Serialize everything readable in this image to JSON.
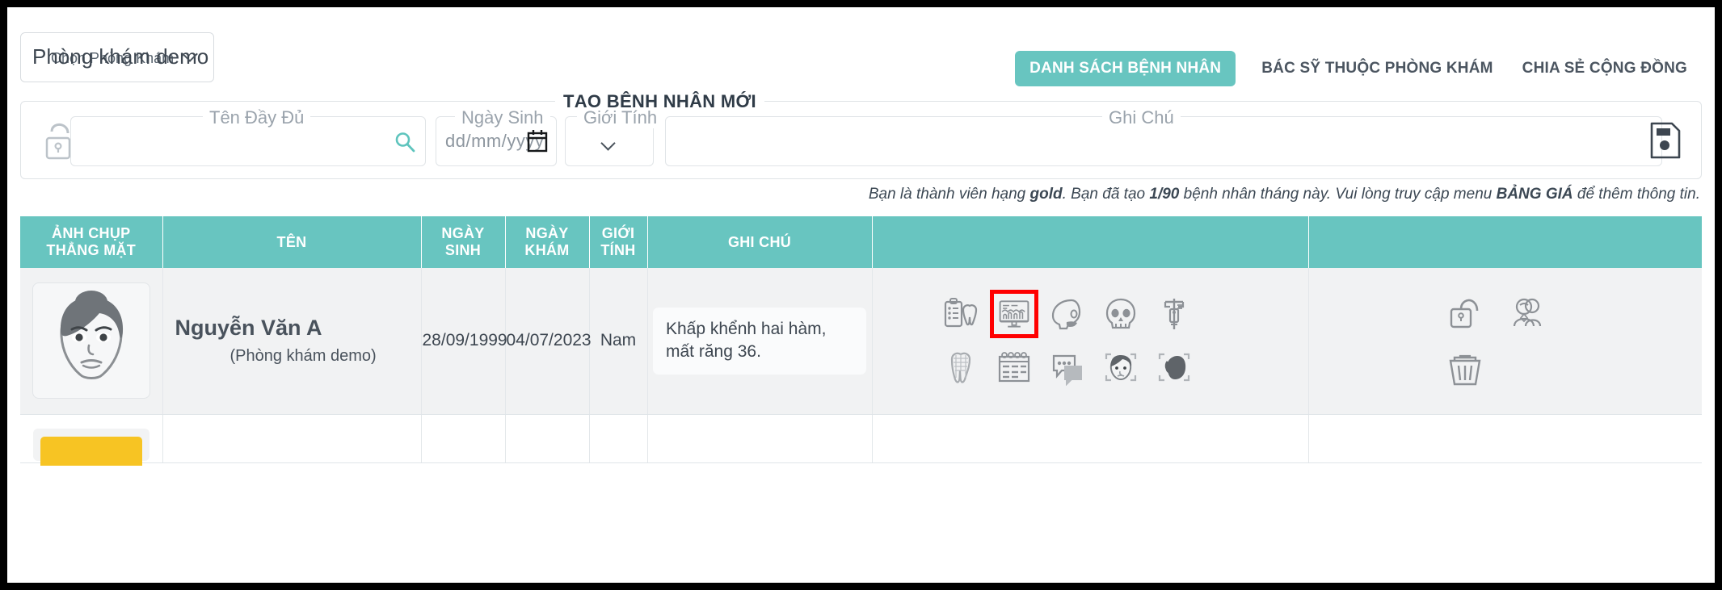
{
  "clinic_selector": {
    "legend": "Chọn Phòng Khám",
    "value": "Phòng khám demo",
    "caret_icon": "chevron-down-icon"
  },
  "nav": {
    "items": [
      {
        "label": "DANH SÁCH BỆNH NHÂN",
        "active": true
      },
      {
        "label": "BÁC SỸ THUỘC PHÒNG KHÁM",
        "active": false
      },
      {
        "label": "CHIA SẺ CỘNG ĐỒNG",
        "active": false
      }
    ]
  },
  "create_patient": {
    "legend": "TẠO BỆNH NHÂN MỚI",
    "lock_icon": "unlock-icon",
    "save_icon": "save-floppy-icon",
    "fields": {
      "full_name": {
        "legend": "Tên Đầy Đủ",
        "value": "",
        "placeholder": "",
        "icon": "search-icon"
      },
      "birth_date": {
        "legend": "Ngày Sinh",
        "value": "",
        "placeholder": "dd/mm/yyyy",
        "icon": "calendar-icon"
      },
      "gender": {
        "legend": "Giới Tính",
        "value": "",
        "icon": "chevron-down-icon"
      },
      "note": {
        "legend": "Ghi Chú",
        "value": "",
        "placeholder": ""
      }
    }
  },
  "quota_note": {
    "part1": "Bạn là thành viên hạng ",
    "tier": "gold",
    "part2": ". Bạn đã tạo ",
    "count": "1/90",
    "part3": " bệnh nhân tháng này.  Vui lòng truy cập menu ",
    "menu": "BẢNG GIÁ",
    "part4": " để thêm thông tin."
  },
  "table": {
    "headers": [
      "ẢNH CHỤP THẲNG MẶT",
      "TÊN",
      "NGÀY SINH",
      "NGÀY KHÁM",
      "GIỚI TÍNH",
      "GHI CHÚ",
      "",
      ""
    ],
    "rows": [
      {
        "avatar_icon": "patient-face-avatar",
        "name": "Nguyễn Văn A",
        "clinic": "(Phòng khám demo)",
        "birth_date": "28/09/1999",
        "exam_date": "04/07/2023",
        "gender": "Nam",
        "note": "Khấp khểnh hai hàm, mất răng 36.",
        "action_icons": [
          {
            "name": "dental-chart-icon",
            "highlighted": false
          },
          {
            "name": "xray-monitor-icon",
            "highlighted": true
          },
          {
            "name": "skull-profile-icon",
            "highlighted": false
          },
          {
            "name": "skull-front-icon",
            "highlighted": false
          },
          {
            "name": "caliper-icon",
            "highlighted": false
          },
          {
            "name": "tooth-3d-icon",
            "highlighted": false
          },
          {
            "name": "calendar-schedule-icon",
            "highlighted": false
          },
          {
            "name": "chat-bubbles-icon",
            "highlighted": false
          },
          {
            "name": "face-scan-front-icon",
            "highlighted": false
          },
          {
            "name": "face-scan-profile-icon",
            "highlighted": false
          }
        ],
        "right_icons": [
          {
            "name": "unlock-icon"
          },
          {
            "name": "share-users-icon"
          },
          {
            "name": "trash-icon"
          }
        ]
      }
    ]
  },
  "colors": {
    "accent_teal": "#68c5c0",
    "highlight_red": "#ff0000",
    "row_background": "#f1f2f3",
    "text_dark": "#3d4650",
    "yellow_chip": "#f7c423"
  }
}
